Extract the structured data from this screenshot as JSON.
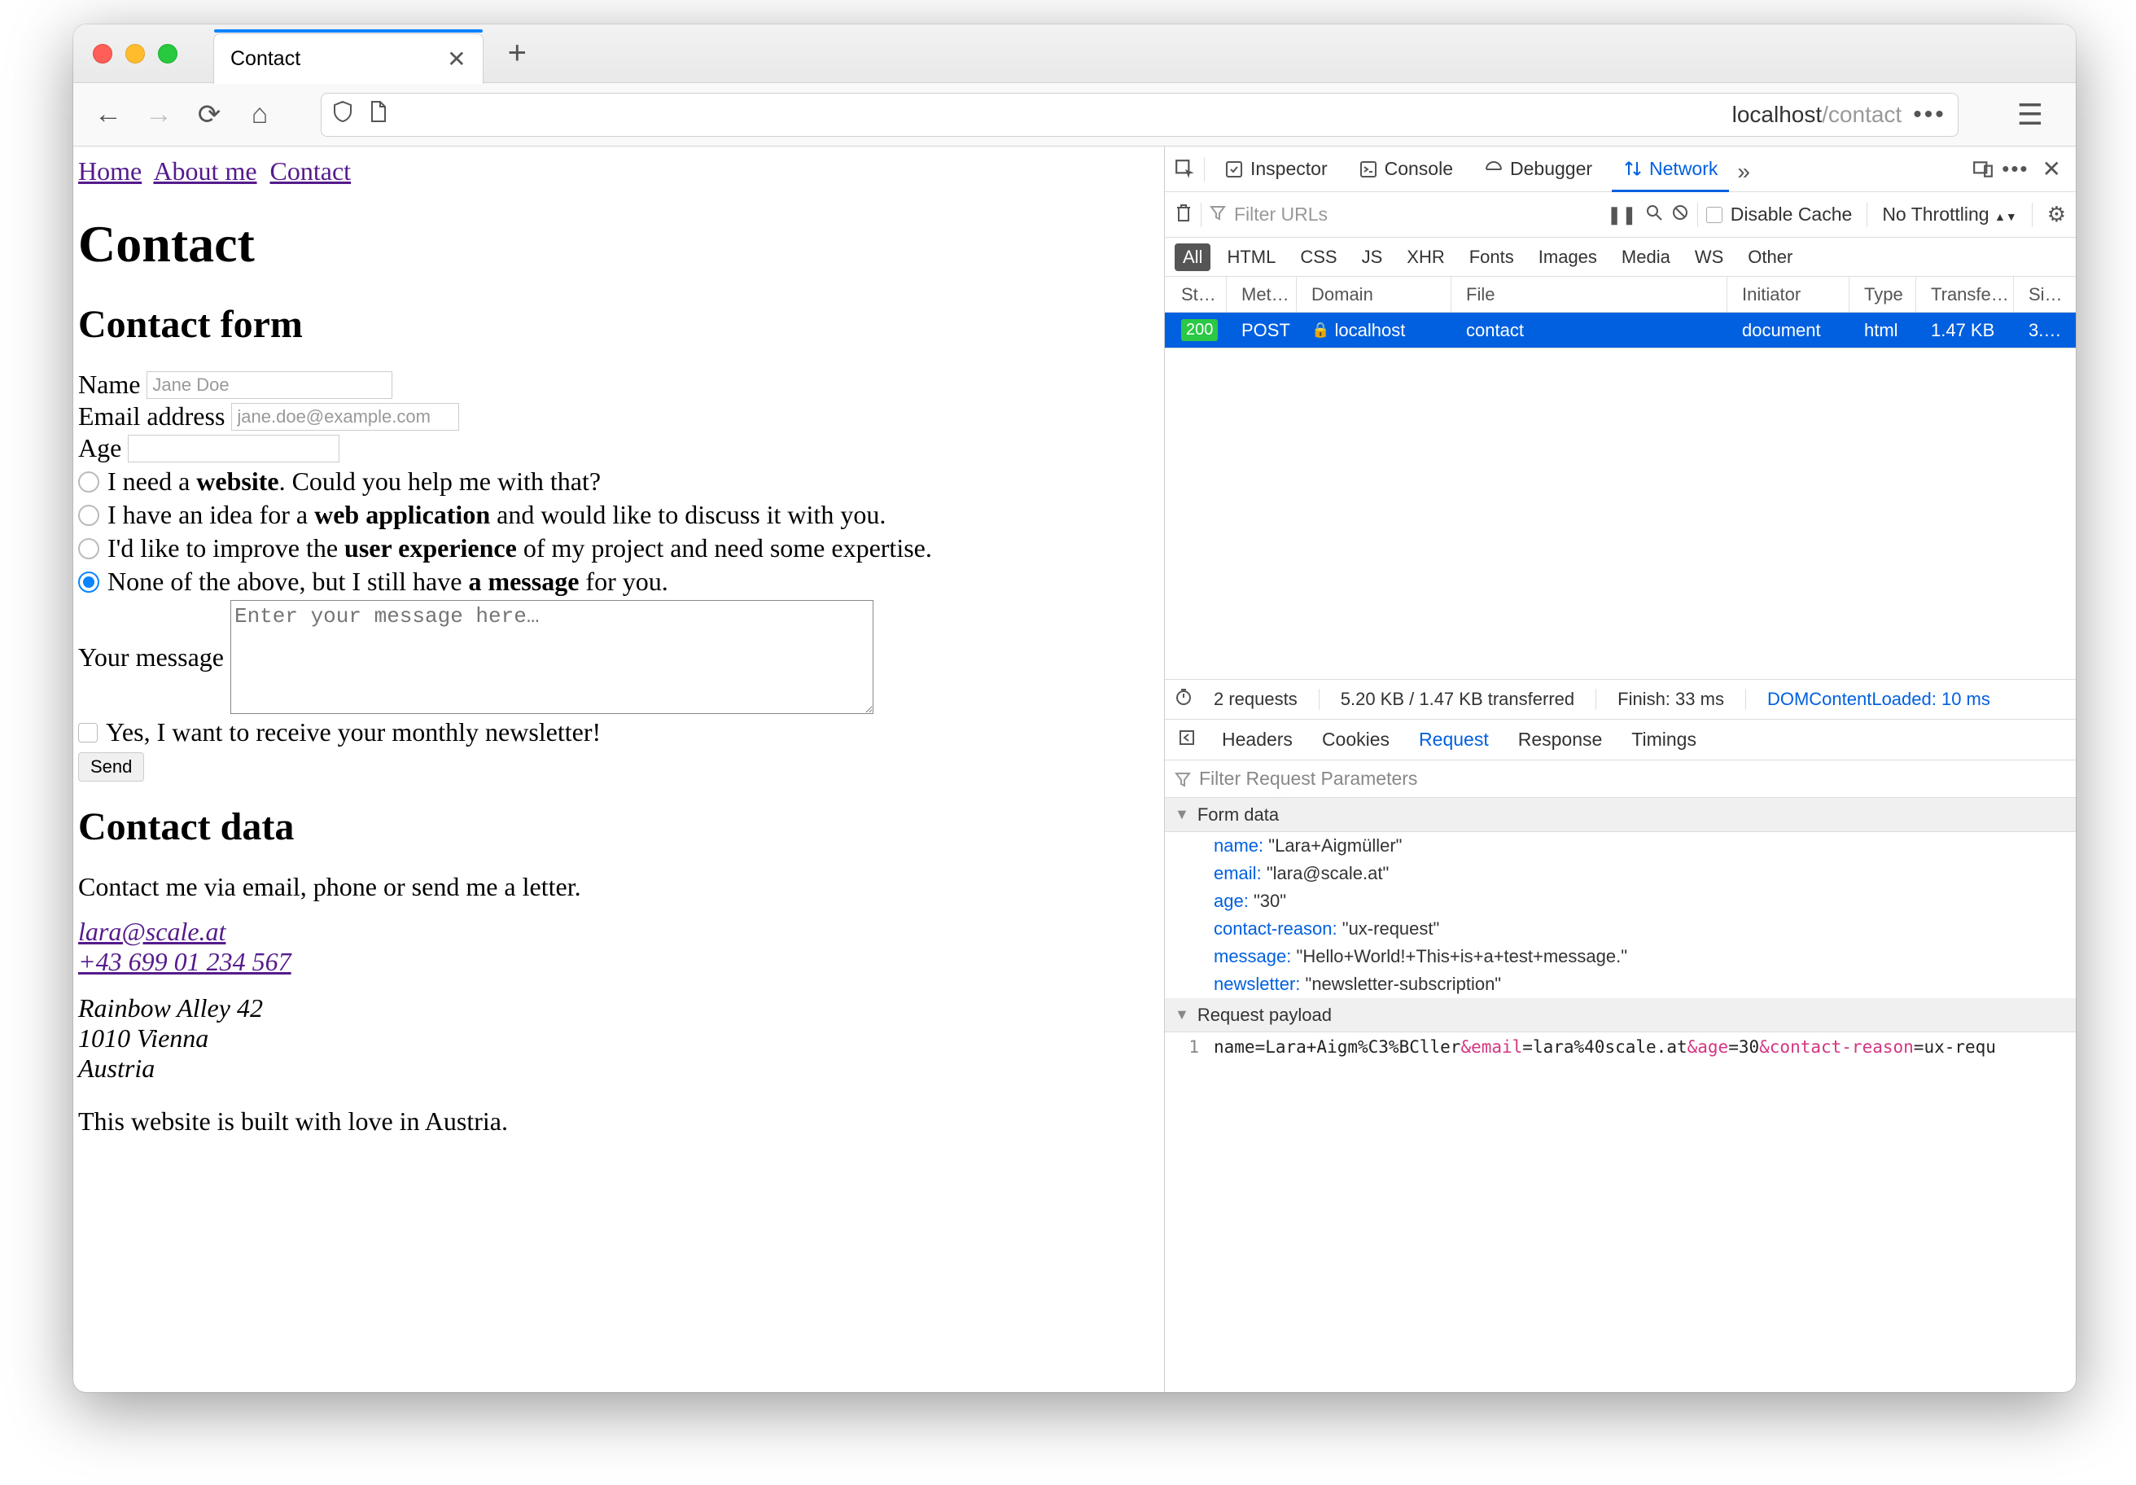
{
  "browser": {
    "tab_title": "Contact",
    "url_host": "localhost",
    "url_path": "/contact"
  },
  "page": {
    "nav": {
      "home": "Home",
      "about": "About me",
      "contact": "Contact"
    },
    "h1": "Contact",
    "h2_form": "Contact form",
    "labels": {
      "name": "Name",
      "email": "Email address",
      "age": "Age",
      "msg": "Your message"
    },
    "placeholders": {
      "name": "Jane Doe",
      "email": "jane.doe@example.com",
      "msg": "Enter your message here…"
    },
    "radio": {
      "r1_pre": "I need a ",
      "r1_b": "website",
      "r1_post": ". Could you help me with that?",
      "r2_pre": "I have an idea for a ",
      "r2_b": "web application",
      "r2_post": " and would like to discuss it with you.",
      "r3_pre": "I'd like to improve the ",
      "r3_b": "user experience",
      "r3_post": " of my project and need some expertise.",
      "r4_pre": "None of the above, but I still have ",
      "r4_b": "a message",
      "r4_post": " for you."
    },
    "newsletter_label": "Yes, I want to receive your monthly newsletter!",
    "send": "Send",
    "h2_data": "Contact data",
    "data_intro": "Contact me via email, phone or send me a letter.",
    "email": "lara@scale.at",
    "phone": "+43 699 01 234 567",
    "addr1": "Rainbow Alley 42",
    "addr2": "1010 Vienna",
    "addr3": "Austria",
    "footer": "This website is built with love in Austria."
  },
  "devtools": {
    "tabs": {
      "inspector": "Inspector",
      "console": "Console",
      "debugger": "Debugger",
      "network": "Network"
    },
    "filter_placeholder": "Filter URLs",
    "disable_cache": "Disable Cache",
    "throttle": "No Throttling",
    "types": [
      "All",
      "HTML",
      "CSS",
      "JS",
      "XHR",
      "Fonts",
      "Images",
      "Media",
      "WS",
      "Other"
    ],
    "headers": {
      "status": "St…",
      "method": "Met…",
      "domain": "Domain",
      "file": "File",
      "initiator": "Initiator",
      "type": "Type",
      "transfer": "Transfe…",
      "size": "Si…"
    },
    "row": {
      "status": "200",
      "method": "POST",
      "domain": "localhost",
      "file": "contact",
      "initiator": "document",
      "type": "html",
      "transfer": "1.47 KB",
      "size": "3.…"
    },
    "summary": {
      "requests": "2 requests",
      "transferred": "5.20 KB / 1.47 KB transferred",
      "finish": "Finish: 33 ms",
      "dom": "DOMContentLoaded: 10 ms"
    },
    "detail_tabs": {
      "headers": "Headers",
      "cookies": "Cookies",
      "request": "Request",
      "response": "Response",
      "timings": "Timings"
    },
    "filter_params": "Filter Request Parameters",
    "section_form": "Form data",
    "form": {
      "k1": "name:",
      "v1": "\"Lara+Aigmüller\"",
      "k2": "email:",
      "v2": "\"lara@scale.at\"",
      "k3": "age:",
      "v3": "\"30\"",
      "k4": "contact-reason:",
      "v4": "\"ux-request\"",
      "k5": "message:",
      "v5": "\"Hello+World!+This+is+a+test+message.\"",
      "k6": "newsletter:",
      "v6": "\"newsletter-subscription\""
    },
    "section_payload": "Request payload",
    "payload_line_no": "1",
    "payload": {
      "s1": "name=",
      "s2": "Lara+Aigm%C3%BCller",
      "s3": "&email",
      "s4": "=",
      "s5": "lara%40scale.at",
      "s6": "&age",
      "s7": "=",
      "s8": "30",
      "s9": "&contact-reason",
      "s10": "=",
      "s11": "ux-requ"
    }
  }
}
